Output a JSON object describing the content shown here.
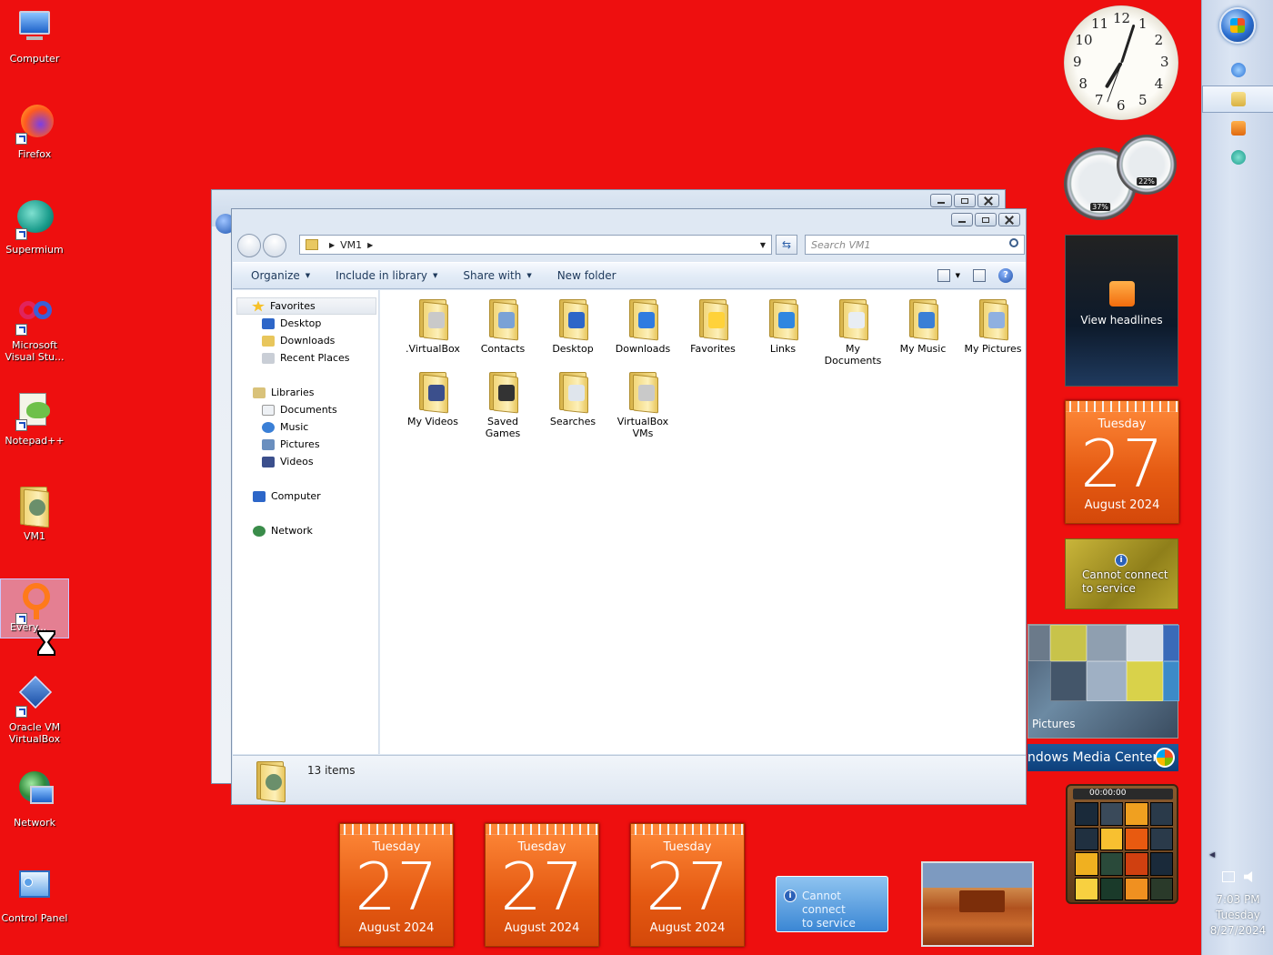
{
  "desktop": {
    "icons": [
      {
        "label": "Computer"
      },
      {
        "label": "Firefox"
      },
      {
        "label": "Supermium"
      },
      {
        "label": "Microsoft Visual Stu..."
      },
      {
        "label": "Notepad++"
      },
      {
        "label": "VM1"
      },
      {
        "label": "Every..."
      },
      {
        "label": "Oracle VM VirtualBox"
      },
      {
        "label": "Network"
      },
      {
        "label": "Control Panel"
      }
    ]
  },
  "explorer": {
    "address": {
      "path": "VM1"
    },
    "search_placeholder": "Search VM1",
    "toolbar": {
      "organize": "Organize",
      "include": "Include in library",
      "share": "Share with",
      "new_folder": "New folder",
      "help": "?"
    },
    "nav": {
      "favorites": "Favorites",
      "desktop": "Desktop",
      "downloads": "Downloads",
      "recent": "Recent Places",
      "libraries": "Libraries",
      "documents": "Documents",
      "music": "Music",
      "pictures": "Pictures",
      "videos": "Videos",
      "computer": "Computer",
      "network": "Network"
    },
    "items": [
      {
        "label": ".VirtualBox",
        "badge": "#c9c9c9"
      },
      {
        "label": "Contacts",
        "badge": "#7aa2d6"
      },
      {
        "label": "Desktop",
        "badge": "#2d66c8"
      },
      {
        "label": "Downloads",
        "badge": "#2f7be0"
      },
      {
        "label": "Favorites",
        "badge": "#ffd23a"
      },
      {
        "label": "Links",
        "badge": "#2f86e0"
      },
      {
        "label": "My Documents",
        "badge": "#e8edf3"
      },
      {
        "label": "My Music",
        "badge": "#3a7fd6"
      },
      {
        "label": "My Pictures",
        "badge": "#8fb0e0"
      },
      {
        "label": "My Videos",
        "badge": "#3b4f8c"
      },
      {
        "label": "Saved Games",
        "badge": "#333333"
      },
      {
        "label": "Searches",
        "badge": "#dfe5ec"
      },
      {
        "label": "VirtualBox VMs",
        "badge": "#c9c9c9"
      }
    ],
    "status": "13 items"
  },
  "gadgets": {
    "calendar": {
      "day": "Tuesday",
      "date": "27",
      "month": "August 2024"
    },
    "feeds": {
      "text": "View headlines"
    },
    "weather": {
      "line1": "Cannot connect",
      "line2": "to service",
      "info": "i"
    },
    "cpu": {
      "cpu_pct": "37%",
      "mem_pct": "22%"
    },
    "pictures": {
      "label": "Pictures"
    },
    "media_center": {
      "label": "ndows Media Center"
    },
    "puzzle": {
      "timer": "00:00:00"
    }
  },
  "clock": {
    "numbers": [
      "12",
      "1",
      "2",
      "3",
      "4",
      "5",
      "6",
      "7",
      "8",
      "9",
      "10",
      "11"
    ]
  },
  "taskbar": {
    "time": "7:03 PM",
    "day": "Tuesday",
    "date": "8/27/2024"
  }
}
